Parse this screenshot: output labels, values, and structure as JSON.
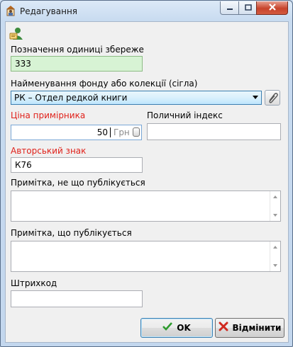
{
  "window": {
    "title": "Редагування",
    "icon": "user-edit-icon",
    "controls": {
      "minimize": "minimize-icon",
      "maximize": "maximize-icon",
      "close": "close-icon"
    }
  },
  "form": {
    "toolbar_icon": "user-card-icon",
    "unit_designation": {
      "label": "Позначення одиниці збереже",
      "value": "333"
    },
    "fund_collection": {
      "label": "Найменування фонду або колекції (сігла)",
      "selected": "РК – Отдел редкой книги"
    },
    "copy_price": {
      "label": "Ціна примірника",
      "value": "50",
      "unit": "Грн"
    },
    "shelf_index": {
      "label": "Поличний індекс",
      "value": ""
    },
    "author_mark": {
      "label": "Авторський знак",
      "value": "К76"
    },
    "note_unpublished": {
      "label": "Примітка, не що публікується",
      "value": ""
    },
    "note_published": {
      "label": "Примітка, що публікується",
      "value": ""
    },
    "barcode": {
      "label": "Штрихкод",
      "value": ""
    }
  },
  "buttons": {
    "ok": {
      "label": "OK",
      "icon": "checkmark-icon"
    },
    "cancel": {
      "label": "Відмінити",
      "icon": "cross-icon"
    }
  },
  "colors": {
    "required_label": "#e0211a",
    "valid_field_bg": "#d7f3d4"
  }
}
